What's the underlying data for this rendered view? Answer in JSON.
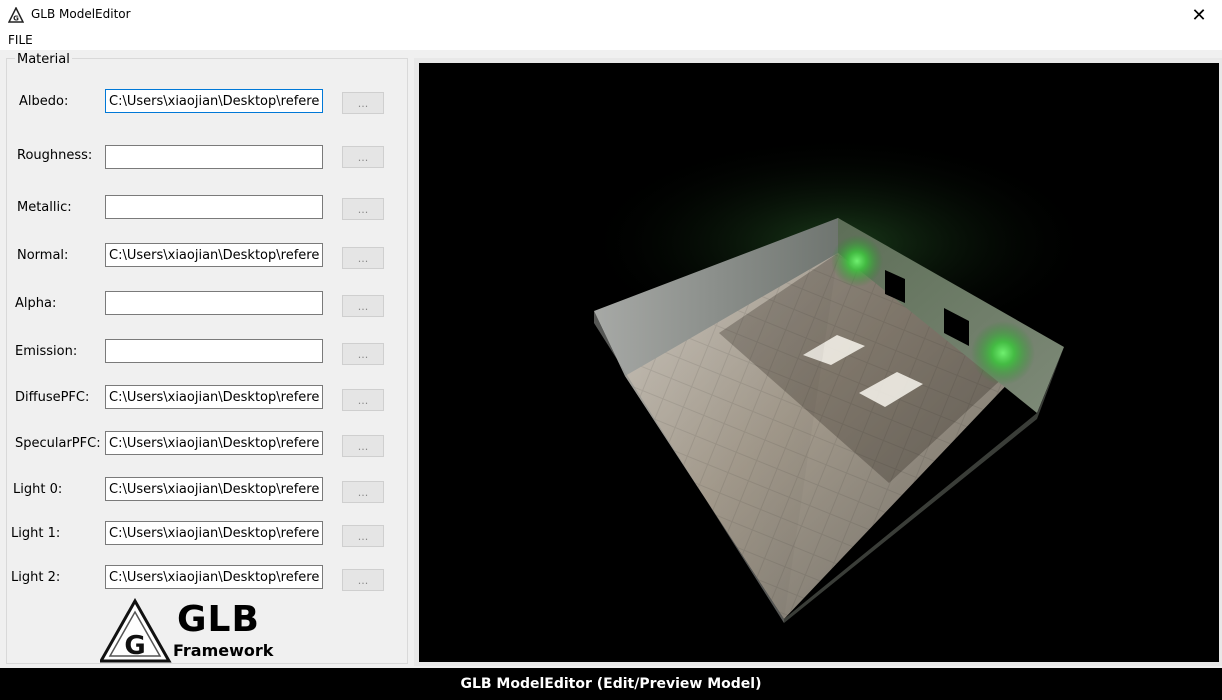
{
  "window": {
    "title": "GLB ModelEditor",
    "close_glyph": "✕",
    "icon": "glb-logo-icon"
  },
  "menu": {
    "file_label": "FILE"
  },
  "material": {
    "group_title": "Material",
    "browse_label": "...",
    "rows": [
      {
        "label": "Albedo:",
        "value": "C:\\Users\\xiaojian\\Desktop\\reference"
      },
      {
        "label": "Roughness:",
        "value": ""
      },
      {
        "label": "Metallic:",
        "value": ""
      },
      {
        "label": "Normal:",
        "value": "C:\\Users\\xiaojian\\Desktop\\reference"
      },
      {
        "label": "Alpha:",
        "value": ""
      },
      {
        "label": "Emission:",
        "value": ""
      },
      {
        "label": "DiffusePFC:",
        "value": "C:\\Users\\xiaojian\\Desktop\\reference"
      },
      {
        "label": "SpecularPFC:",
        "value": "C:\\Users\\xiaojian\\Desktop\\reference"
      },
      {
        "label": "Light 0:",
        "value": "C:\\Users\\xiaojian\\Desktop\\reference"
      },
      {
        "label": "Light 1:",
        "value": "C:\\Users\\xiaojian\\Desktop\\reference"
      },
      {
        "label": "Light 2:",
        "value": "C:\\Users\\xiaojian\\Desktop\\reference"
      }
    ]
  },
  "logo": {
    "name": "GLB",
    "sub": "Framework",
    "icon_letter": "G"
  },
  "viewport": {
    "background": "#000000",
    "light_color": "#4ed64e"
  },
  "caption": {
    "text": "GLB ModelEditor (Edit/Preview Model)"
  }
}
